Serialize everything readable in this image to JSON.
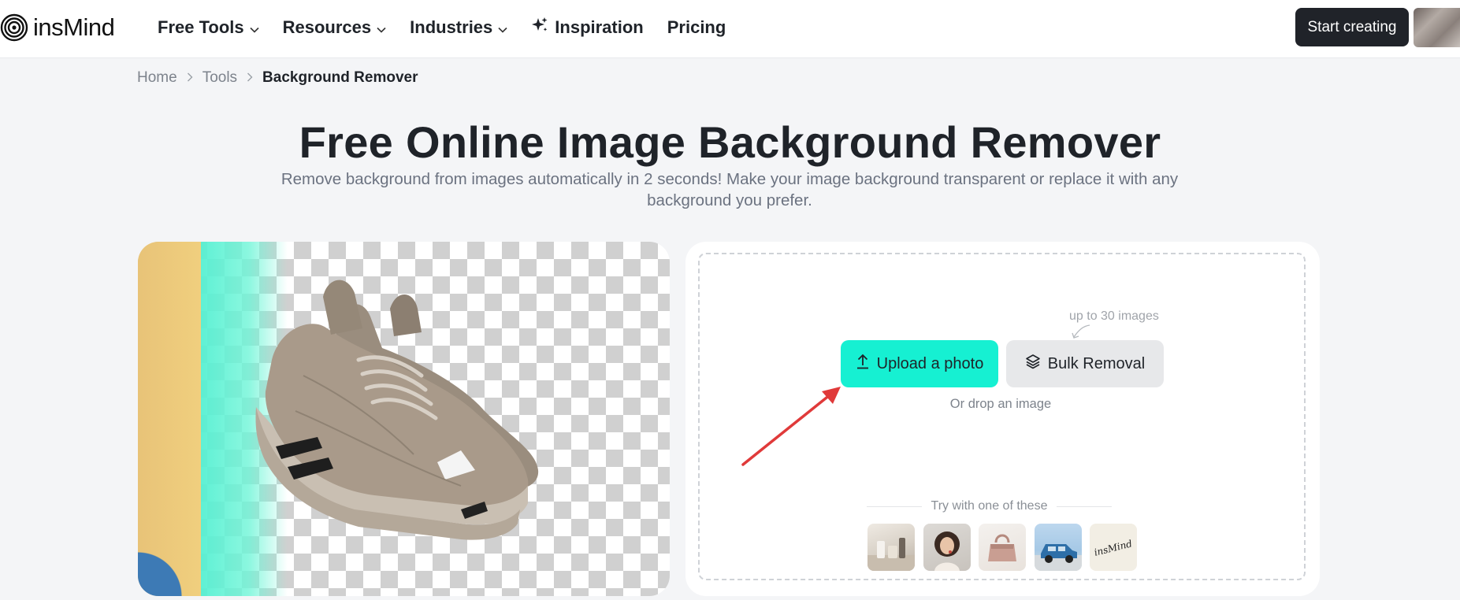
{
  "header": {
    "logo_text": "insMind",
    "nav": [
      {
        "label": "Free Tools",
        "has_dropdown": true
      },
      {
        "label": "Resources",
        "has_dropdown": true
      },
      {
        "label": "Industries",
        "has_dropdown": true
      },
      {
        "label": "Inspiration",
        "icon": "sparkle-icon"
      },
      {
        "label": "Pricing"
      }
    ],
    "start_label": "Start creating"
  },
  "breadcrumb": [
    "Home",
    "Tools",
    "Background Remover"
  ],
  "hero": {
    "title": "Free Online Image Background Remover",
    "subtitle": "Remove background from images automatically in 2 seconds! Make your image background transparent or replace it with any background you prefer."
  },
  "upload": {
    "limit_note": "up to 30 images",
    "upload_label": "Upload a photo",
    "bulk_label": "Bulk Removal",
    "drop_hint": "Or drop an image",
    "try_label": "Try with one of these",
    "sample_5_text": "insMind"
  },
  "colors": {
    "accent": "#16f0d2",
    "dark_button": "#202329",
    "annotation_arrow": "#e03a3a"
  }
}
